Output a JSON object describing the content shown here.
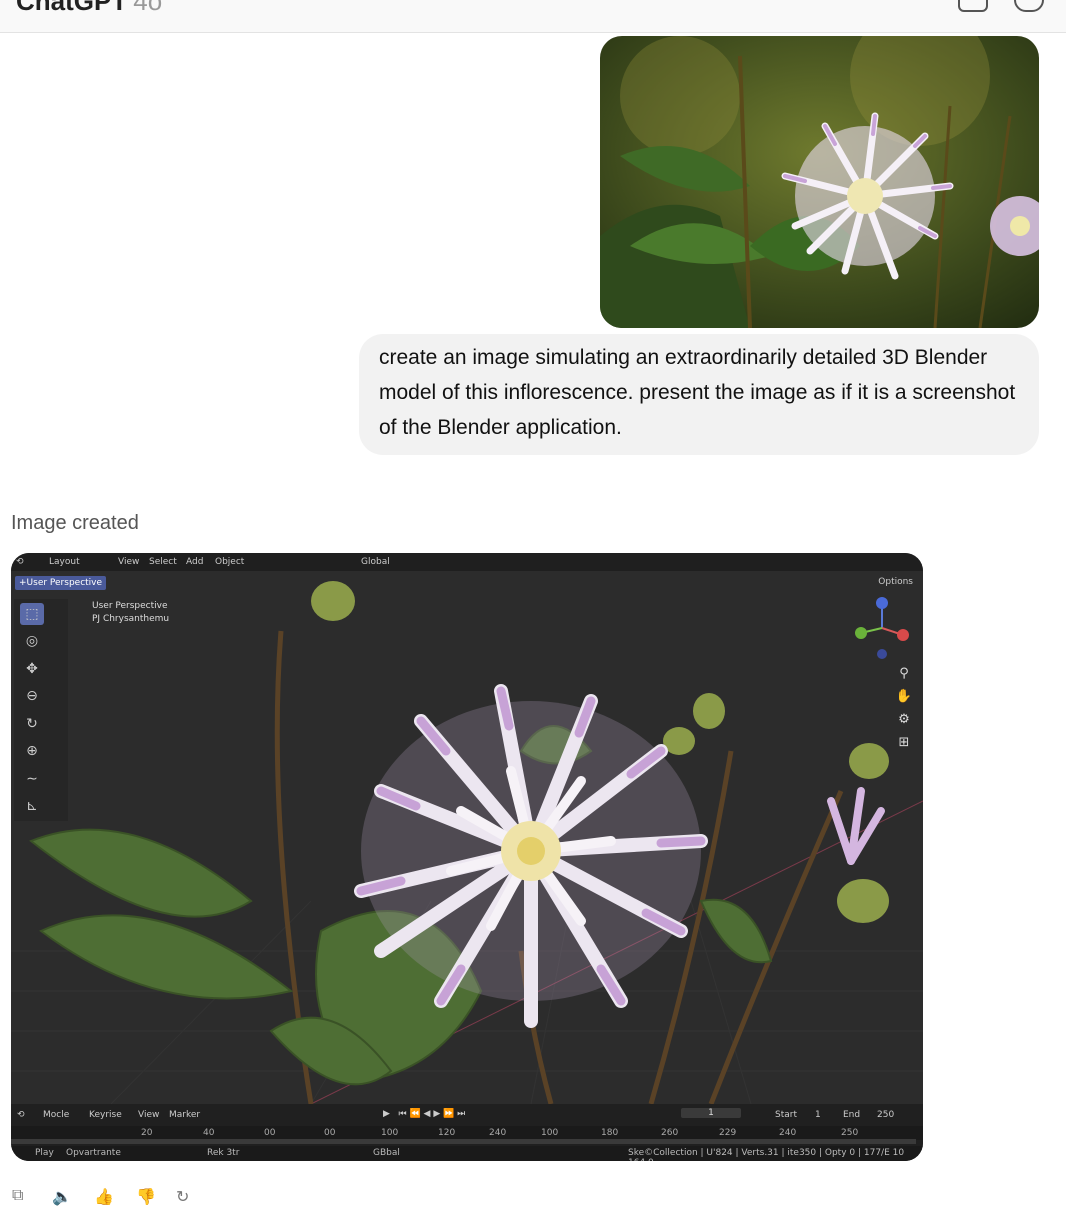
{
  "header": {
    "title": "ChatGPT",
    "version": "4o"
  },
  "user_message": {
    "image_alt": "Photo of a white and lilac spider dahlia",
    "text": "create an image simulating an extraordinarily detailed 3D Blender model of this inflorescence. present the image as if it is a screenshot of the Blender application."
  },
  "assistant": {
    "status": "Image created"
  },
  "blender": {
    "menu": {
      "layout": "Layout",
      "view": "View",
      "select": "Select",
      "add": "Add",
      "object": "Object",
      "transform": "Global",
      "options": "Options"
    },
    "viewport_button": "+User Perspective",
    "overlay": {
      "line1": "User Perspective",
      "line2": "PJ Chrysanthemu"
    },
    "timeline": {
      "mode": "Mocle",
      "keying": "Keyrise",
      "view": "View",
      "marker": "Marker",
      "current_frame": "1",
      "start_label": "Start",
      "start": "1",
      "end_label": "End",
      "end": "250",
      "ticks": [
        "20",
        "40",
        "00",
        "00",
        "100",
        "120",
        "240",
        "100",
        "180",
        "260",
        "229",
        "240",
        "250"
      ]
    },
    "statusbar": {
      "play": "Play",
      "item2": "Opvartrante",
      "item3": "Rek 3tr",
      "item4": "GBbal",
      "stats": "Ske©Collection  | U'824 | Verts.31 | ite350 | Opty 0 | 177/E 10 164.0"
    }
  },
  "actions": [
    "copy-icon",
    "speaker-icon",
    "thumbs-up-icon",
    "thumbs-down-icon",
    "regenerate-icon"
  ]
}
